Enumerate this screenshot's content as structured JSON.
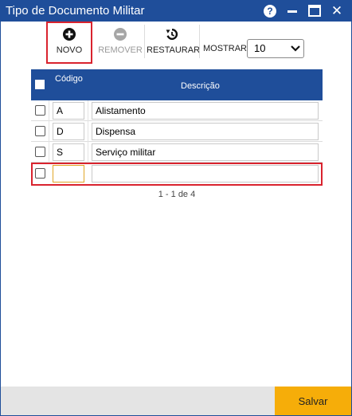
{
  "window": {
    "title": "Tipo de Documento Militar",
    "help_label": "?",
    "close_label": "✕"
  },
  "toolbar": {
    "new_label": "NOVO",
    "remove_label": "REMOVER",
    "restore_label": "RESTAURAR",
    "show_label": "MOSTRAR:",
    "page_size": "10"
  },
  "grid": {
    "columns": [
      "Código",
      "Descrição"
    ],
    "rows": [
      {
        "code": "A",
        "description": "Alistamento"
      },
      {
        "code": "D",
        "description": "Dispensa"
      },
      {
        "code": "S",
        "description": "Serviço militar"
      }
    ],
    "new_row": {
      "code": "",
      "description": ""
    }
  },
  "pager": {
    "summary": "1 - 1 de 4"
  },
  "footer": {
    "save_label": "Salvar"
  },
  "colors": {
    "header": "#1f4e9a",
    "accent_save": "#f6ad09",
    "highlight": "#d9232e"
  },
  "icons": {
    "new": "plus-circle-icon",
    "remove": "minus-circle-icon",
    "restore": "restore-icon",
    "dropdown": "chevron-down-icon"
  }
}
